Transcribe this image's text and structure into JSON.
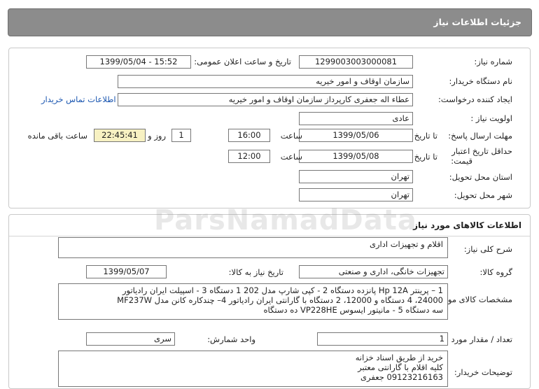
{
  "header": {
    "title": "جزئیات اطلاعات نیاز"
  },
  "watermark": "ParsNamadData",
  "details": {
    "need_number_label": "شماره نیاز:",
    "need_number": "1299003003000081",
    "announce_label": "تاریخ و ساعت اعلان عمومی:",
    "announce_value": "1399/05/04 - 15:52",
    "buyer_org_label": "نام دستگاه خریدار:",
    "buyer_org": "سازمان اوقاف و امور خیریه",
    "requester_label": "ایجاد کننده درخواست:",
    "requester": "عطاء اله جعفری کارپرداز سازمان اوقاف و امور خیریه",
    "contact_link": "اطلاعات تماس خریدار",
    "priority_label": "اولویت نیاز :",
    "priority": "عادی",
    "deadline_label": "مهلت ارسال پاسخ:",
    "to_date_label": "تا تاریخ :",
    "deadline_date": "1399/05/06",
    "time_label": "ساعت",
    "deadline_time": "16:00",
    "days_value": "1",
    "days_label": "روز و",
    "remaining_time": "22:45:41",
    "remaining_label": "ساعت باقی مانده",
    "validity_label_1": "حداقل تاریخ اعتبار",
    "validity_label_2": "قیمت:",
    "validity_date": "1399/05/08",
    "validity_time": "12:00",
    "province_label": "استان محل تحویل:",
    "province": "تهران",
    "city_label": "شهر محل تحویل:",
    "city": "تهران"
  },
  "goods": {
    "section_title": "اطلاعات کالاهای مورد نیاز",
    "general_desc_label": "شرح کلی نیاز:",
    "general_desc": "اقلام و تجهیزات اداری",
    "group_label": "گروه کالا:",
    "group": "تجهیزات خانگی، اداری و صنعتی",
    "need_date_label": "تاریخ نیاز به کالا:",
    "need_date": "1399/05/07",
    "specs_label": "مشخصات کالای مورد نیاز:",
    "specs_lines": [
      "1 – پرینتر Hp 12A  پانزده دستگاه  2 - کپی شارپ مدل 202   1 دستگاه  3 - اسپیلت ایران رادیاتور",
      "24000، 4 دستگاه  و 12000، 2 دستگاه  با گارانتی ایران رادیاتور  4–  چندکاره کانن مدل  MF237W",
      "سه دستگاه   5 - مانیتور ایسوس    VP228HE    ده دستگاه"
    ],
    "qty_label": "تعداد / مقدار مورد نیاز:",
    "qty": "1",
    "unit_label": "واحد شمارش:",
    "unit": "سری",
    "buyer_notes_label": "توضیحات خریدار:",
    "buyer_notes_lines": [
      "خرید از طریق اسناد خزانه",
      "کلیه اقلام با گارانتی معتبر",
      "09123216163 جعفری"
    ]
  }
}
